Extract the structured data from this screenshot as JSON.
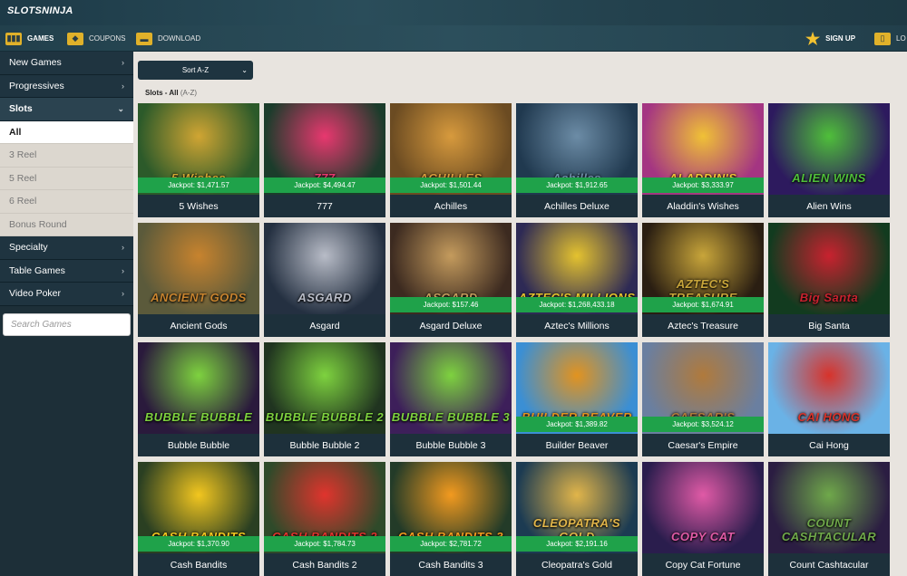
{
  "brand": {
    "logo": "SLOTSNINJA"
  },
  "nav": {
    "games": "GAMES",
    "coupons": "COUPONS",
    "download": "DOWNLOAD",
    "signup": "SIGN UP",
    "login": "LO"
  },
  "sidebar": {
    "items": [
      {
        "label": "New Games"
      },
      {
        "label": "Progressives"
      }
    ],
    "slots": "Slots",
    "slot_subs": [
      "All",
      "3 Reel",
      "5 Reel",
      "6 Reel",
      "Bonus Round"
    ],
    "more": [
      {
        "label": "Specialty"
      },
      {
        "label": "Table Games"
      },
      {
        "label": "Video Poker"
      }
    ],
    "search_placeholder": "Search Games"
  },
  "main": {
    "sort_label": "Sort A-Z",
    "crumb_main": "Slots - All",
    "crumb_sub": "(A-Z)"
  },
  "games": [
    {
      "name": "5 Wishes",
      "jackpot": "Jackpot: $1,471.57",
      "art": "5 Wishes",
      "c1": "#2c5a2a",
      "c2": "#d0a533"
    },
    {
      "name": "777",
      "jackpot": "Jackpot: $4,494.47",
      "art": "777",
      "c1": "#1b3c2b",
      "c2": "#e8386f"
    },
    {
      "name": "Achilles",
      "jackpot": "Jackpot: $1,501.44",
      "art": "ACHILLES",
      "c1": "#6b4b22",
      "c2": "#d79a3d"
    },
    {
      "name": "Achilles Deluxe",
      "jackpot": "Jackpot: $1,912.65",
      "art": "Achilles",
      "c1": "#20394f",
      "c2": "#6c8ca6"
    },
    {
      "name": "Aladdin's Wishes",
      "jackpot": "Jackpot: $3,333.97",
      "art": "ALADDIN'S",
      "c1": "#a43582",
      "c2": "#f0c136"
    },
    {
      "name": "Alien Wins",
      "jackpot": "",
      "art": "ALIEN WINS",
      "c1": "#2d1a5e",
      "c2": "#4fbf3a"
    },
    {
      "name": "Ancient Gods",
      "jackpot": "",
      "art": "ANCIENT GODS",
      "c1": "#5b5a3b",
      "c2": "#c7832e"
    },
    {
      "name": "Asgard",
      "jackpot": "",
      "art": "ASGARD",
      "c1": "#243041",
      "c2": "#b8bcc7"
    },
    {
      "name": "Asgard Deluxe",
      "jackpot": "Jackpot: $157.46",
      "art": "ASGARD",
      "c1": "#3c2a20",
      "c2": "#c49b5d"
    },
    {
      "name": "Aztec's Millions",
      "jackpot": "Jackpot: $1,268,433.18",
      "art": "AZTEC'S MILLIONS",
      "c1": "#2e2a55",
      "c2": "#e4c22f"
    },
    {
      "name": "Aztec's Treasure",
      "jackpot": "Jackpot: $1,674.91",
      "art": "AZTEC'S TREASURE",
      "c1": "#2a1e12",
      "c2": "#c8a53a"
    },
    {
      "name": "Big Santa",
      "jackpot": "",
      "art": "Big Santa",
      "c1": "#123b1f",
      "c2": "#c8222f"
    },
    {
      "name": "Bubble Bubble",
      "jackpot": "",
      "art": "BUBBLE BUBBLE",
      "c1": "#2a1a3c",
      "c2": "#7ed23f"
    },
    {
      "name": "Bubble Bubble 2",
      "jackpot": "",
      "art": "BUBBLE BUBBLE 2",
      "c1": "#203420",
      "c2": "#7ed23f"
    },
    {
      "name": "Bubble Bubble 3",
      "jackpot": "",
      "art": "BUBBLE BUBBLE 3",
      "c1": "#3d1f5a",
      "c2": "#7ed23f"
    },
    {
      "name": "Builder Beaver",
      "jackpot": "Jackpot: $1,389.82",
      "art": "BUILDER BEAVER",
      "c1": "#3b8fd4",
      "c2": "#e2931f"
    },
    {
      "name": "Caesar's Empire",
      "jackpot": "Jackpot: $3,524.12",
      "art": "CAESAR'S",
      "c1": "#6a7fa0",
      "c2": "#b07a3c"
    },
    {
      "name": "Cai Hong",
      "jackpot": "",
      "art": "CAI HONG",
      "c1": "#6ab2e6",
      "c2": "#d7332b"
    },
    {
      "name": "Cash Bandits",
      "jackpot": "Jackpot: $1,370.90",
      "art": "CASH BANDITS",
      "c1": "#2a3f22",
      "c2": "#f2c61f"
    },
    {
      "name": "Cash Bandits 2",
      "jackpot": "Jackpot: $1,784.73",
      "art": "CASH BANDITS 2",
      "c1": "#2f4a2a",
      "c2": "#e0342d"
    },
    {
      "name": "Cash Bandits 3",
      "jackpot": "Jackpot: $2,781.72",
      "art": "CASH BANDITS 3",
      "c1": "#233b28",
      "c2": "#f29a1f"
    },
    {
      "name": "Cleopatra's Gold",
      "jackpot": "Jackpot: $2,191.16",
      "art": "CLEOPATRA'S GOLD",
      "c1": "#1c3b52",
      "c2": "#e1b54a"
    },
    {
      "name": "Copy Cat Fortune",
      "jackpot": "",
      "art": "COPY CAT",
      "c1": "#2a1d4d",
      "c2": "#e05aa6"
    },
    {
      "name": "Count Cashtacular",
      "jackpot": "",
      "art": "COUNT CASHTACULAR",
      "c1": "#2b1d42",
      "c2": "#6fa84a"
    }
  ]
}
